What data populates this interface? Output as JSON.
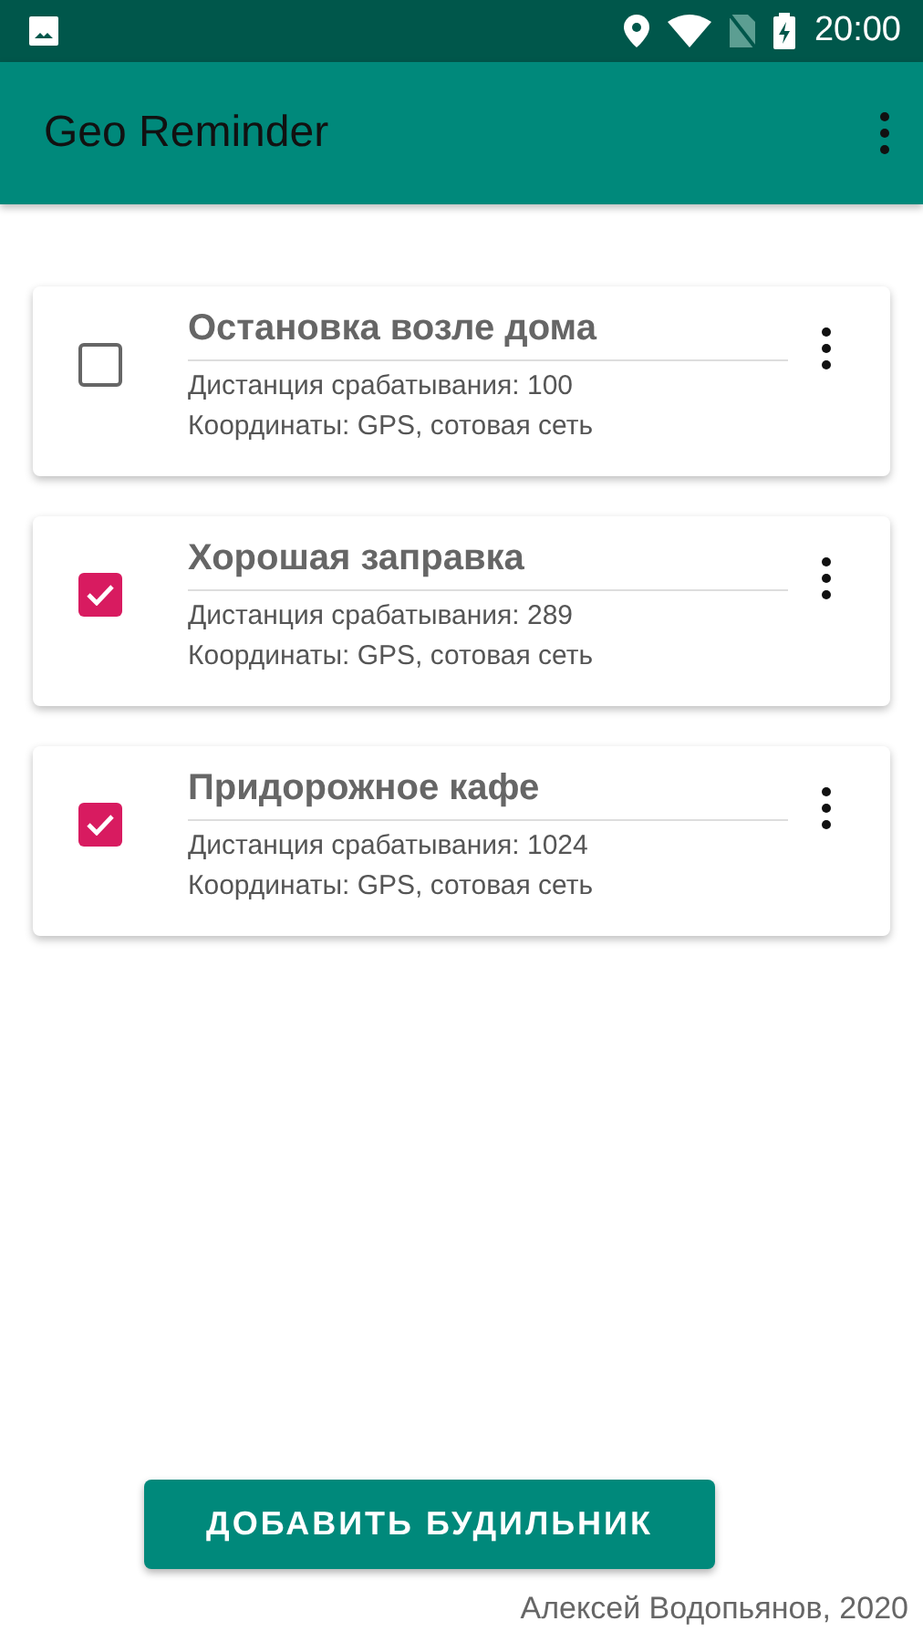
{
  "status_bar": {
    "time": "20:00"
  },
  "app_bar": {
    "title": "Geo Reminder"
  },
  "reminders": [
    {
      "title": "Остановка возле дома",
      "distance": "Дистанция срабатывания: 100",
      "coordinates": "Координаты: GPS, сотовая сеть",
      "checked": false
    },
    {
      "title": "Хорошая заправка",
      "distance": "Дистанция срабатывания: 289",
      "coordinates": "Координаты: GPS, сотовая сеть",
      "checked": true
    },
    {
      "title": "Придорожное кафе",
      "distance": "Дистанция срабатывания: 1024",
      "coordinates": "Координаты: GPS, сотовая сеть",
      "checked": true
    }
  ],
  "add_button": "ДОБАВИТЬ БУДИЛЬНИК",
  "footer": "Алексей Водопьянов, 2020"
}
